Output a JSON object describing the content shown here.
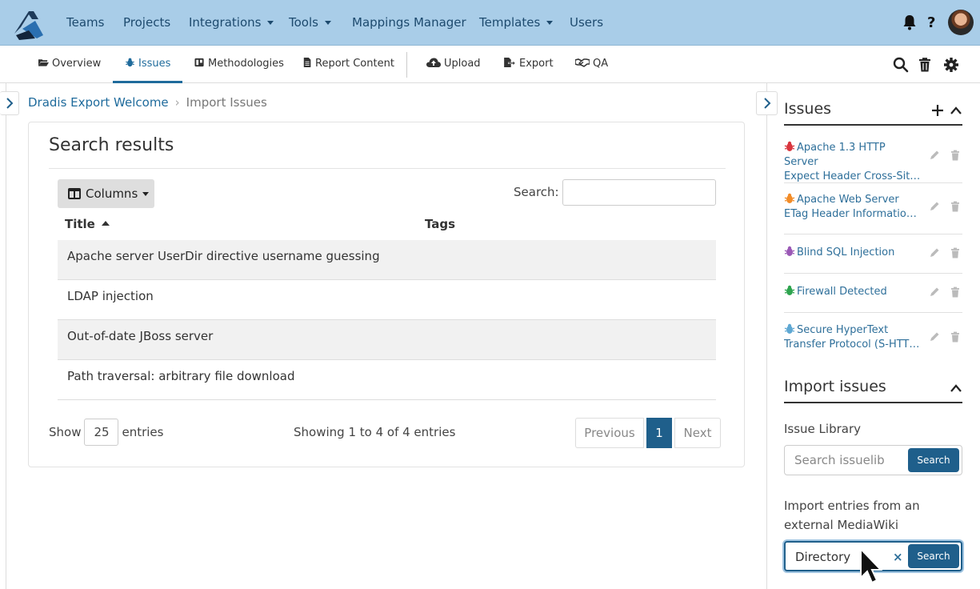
{
  "topnav": {
    "items": [
      "Teams",
      "Projects",
      "Integrations",
      "Tools",
      "Mappings Manager",
      "Templates",
      "Users"
    ]
  },
  "subnav": {
    "tabs": [
      "Overview",
      "Issues",
      "Methodologies",
      "Report Content",
      "Upload",
      "Export",
      "QA"
    ],
    "active": "Issues"
  },
  "breadcrumb": {
    "parent": "Dradis Export Welcome",
    "current": "Import Issues"
  },
  "results": {
    "title": "Search results",
    "columns_label": "Columns",
    "search_label": "Search:",
    "search_value": "",
    "headers": [
      "Title",
      "Tags"
    ],
    "rows": [
      {
        "title": "Apache server UserDir directive username guessing",
        "tags": ""
      },
      {
        "title": "LDAP injection",
        "tags": ""
      },
      {
        "title": "Out-of-date JBoss server",
        "tags": ""
      },
      {
        "title": "Path traversal: arbitrary file download",
        "tags": ""
      }
    ],
    "show_label": "Show",
    "page_size": "25",
    "entries_label": "entries",
    "showing": "Showing 1 to 4 of 4 entries",
    "pagination": {
      "previous": "Previous",
      "page": "1",
      "next": "Next"
    }
  },
  "sidebar": {
    "issues_title": "Issues",
    "issues": [
      {
        "line1": "Apache 1.3 HTTP Server",
        "line2": "Expect Header Cross-Site…",
        "color": "#d9363e"
      },
      {
        "line1": "Apache Web Server",
        "line2": "ETag Header Information…",
        "color": "#f28c28"
      },
      {
        "line1": "Blind SQL Injection",
        "line2": "",
        "color": "#9b59b6"
      },
      {
        "line1": "Firewall Detected",
        "line2": "",
        "color": "#2ea44f"
      },
      {
        "line1": "Secure HyperText",
        "line2": "Transfer Protocol (S-HTTP…",
        "color": "#5fa8d3"
      }
    ],
    "import_title": "Import issues",
    "library_label": "Issue Library",
    "library_placeholder": "Search issuelib",
    "search_button": "Search",
    "mediawiki_label_1": "Import entries from an",
    "mediawiki_label_2": "external MediaWiki",
    "mediawiki_value": "Directory",
    "clear": "×"
  },
  "colors": {
    "topnav_bg": "#a9cde8",
    "accent": "#1f5f8b",
    "link": "#2e6f9a"
  }
}
